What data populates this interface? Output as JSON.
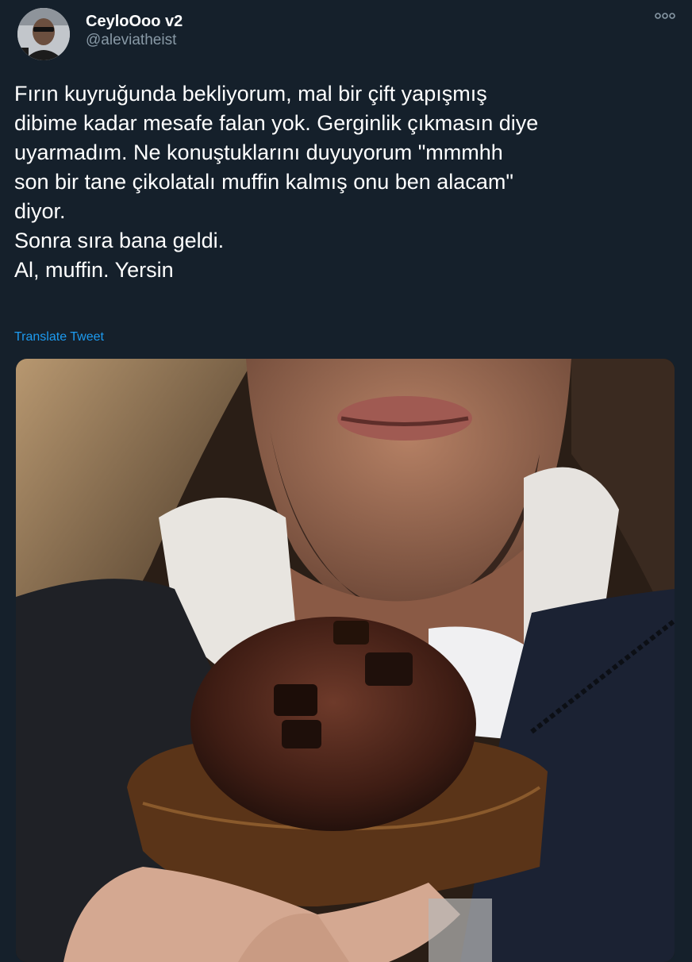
{
  "tweet": {
    "display_name": "CeyloOoo v2",
    "handle": "@aleviatheist",
    "text": "Fırın kuyruğunda bekliyorum, mal bir çift yapışmış\ndibime kadar mesafe falan yok. Gerginlik çıkmasın diye\nuyarmadım. Ne konuştuklarını duyuyorum \"mmmhh\nson bir tane çikolatalı muffin kalmış onu ben alacam\"\ndiyor.\n Sonra sıra bana geldi.\nAl, muffin. Yersin",
    "translate_label": "Translate Tweet"
  },
  "icons": {
    "more": "more-dots-icon",
    "avatar": "user-avatar"
  },
  "colors": {
    "background": "#15202b",
    "link": "#1d9bf0",
    "secondary_text": "#8899a6"
  }
}
